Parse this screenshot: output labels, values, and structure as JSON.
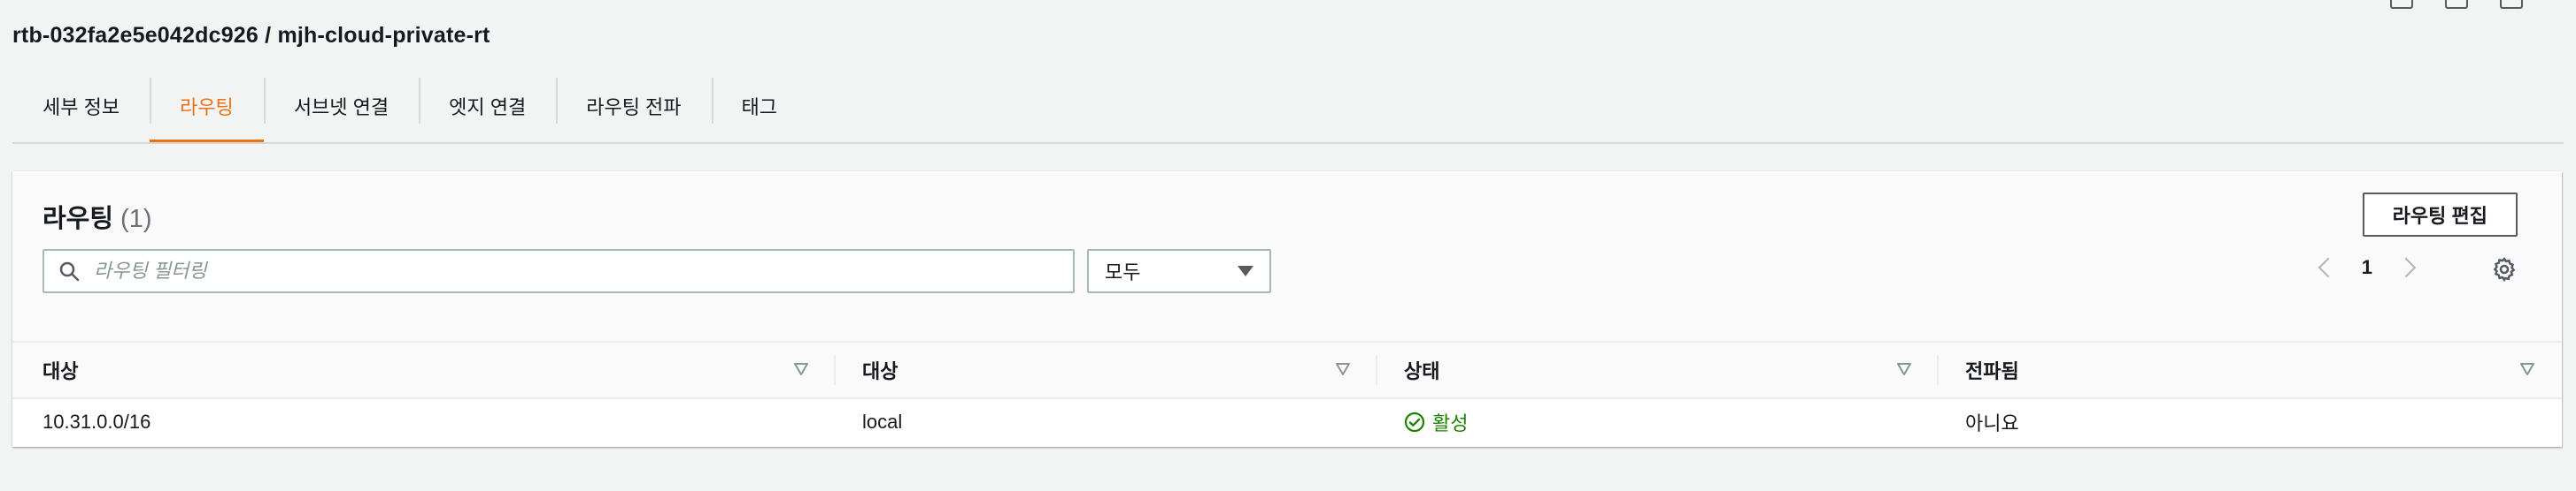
{
  "header": {
    "title": "rtb-032fa2e5e042dc926 / mjh-cloud-private-rt"
  },
  "tabs": [
    {
      "label": "세부 정보",
      "active": false
    },
    {
      "label": "라우팅",
      "active": true
    },
    {
      "label": "서브넷 연결",
      "active": false
    },
    {
      "label": "엣지 연결",
      "active": false
    },
    {
      "label": "라우팅 전파",
      "active": false
    },
    {
      "label": "태그",
      "active": false
    }
  ],
  "routes": {
    "title": "라우팅",
    "count": "(1)",
    "edit_button": "라우팅 편집",
    "filter": {
      "placeholder": "라우팅 필터링",
      "value": ""
    },
    "scope_select": "모두",
    "page": "1",
    "columns": [
      "대상",
      "대상",
      "상태",
      "전파됨"
    ],
    "rows": [
      {
        "destination": "10.31.0.0/16",
        "target": "local",
        "status": "활성",
        "propagated": "아니요"
      }
    ]
  },
  "colors": {
    "accent": "#ec7211",
    "status_active": "#1d8102",
    "text": "#16191f"
  },
  "icons": [
    "window-icon",
    "search-icon",
    "caret-down-icon",
    "chevron-left-icon",
    "chevron-right-icon",
    "gear-icon",
    "sort-icon",
    "check-circle-icon"
  ]
}
